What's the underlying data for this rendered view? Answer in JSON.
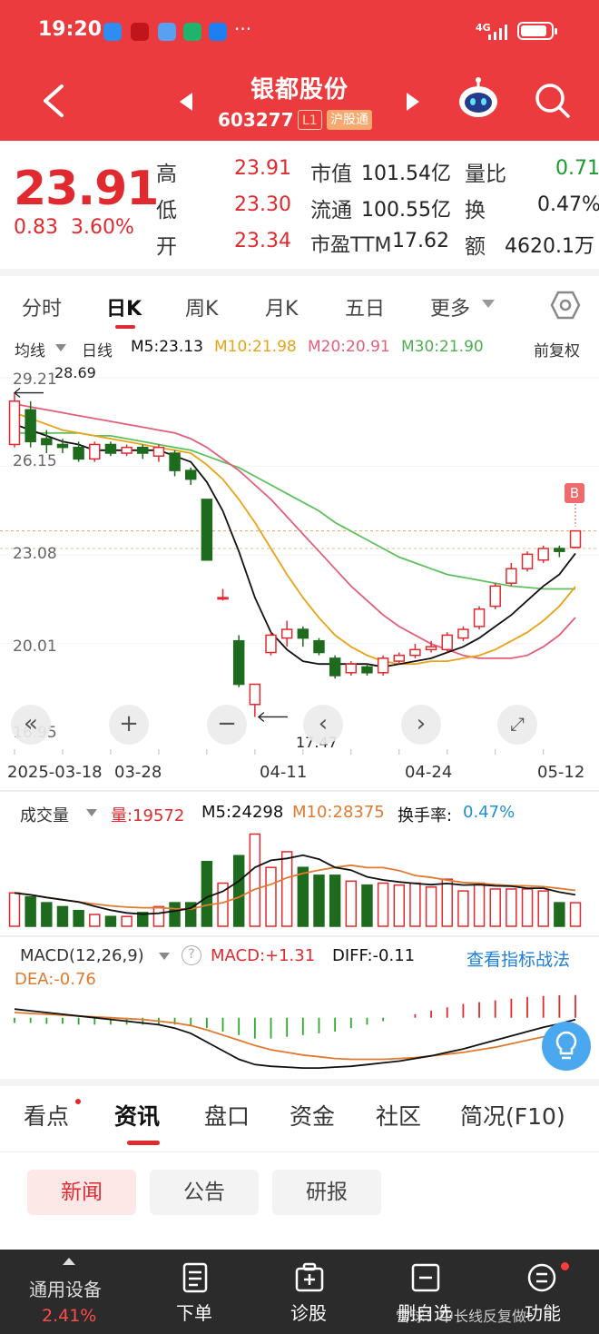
{
  "status_bar": {
    "time": "19:20",
    "more": "···",
    "network": "4G"
  },
  "header": {
    "title": "银都股份",
    "code": "603277",
    "level_badge": "L1",
    "connect_badge": "沪股通"
  },
  "quote": {
    "price": "23.91",
    "change": "0.83",
    "change_pct": "3.60%",
    "high_label": "高",
    "high": "23.91",
    "low_label": "低",
    "low": "23.30",
    "open_label": "开",
    "open": "23.34",
    "mcap_label": "市值",
    "mcap": "101.54亿",
    "float_label": "流通",
    "float": "100.55亿",
    "pe_label": "市盈TTM",
    "pe": "17.62",
    "volratio_label": "量比",
    "volratio": "0.71",
    "turnover_label": "换",
    "turnover": "0.47%",
    "amount_label": "额",
    "amount": "4620.1万"
  },
  "chart_tabs": [
    "分时",
    "日K",
    "周K",
    "月K",
    "五日",
    "更多"
  ],
  "ma_bar": {
    "selector": "均线",
    "period": "日线",
    "ma5": "M5:23.13",
    "ma10": "M10:21.98",
    "ma20": "M20:20.91",
    "ma30": "M30:21.90",
    "adjust": "前复权"
  },
  "price_axis": [
    "29.21",
    "26.15",
    "23.08",
    "20.01",
    "16.95"
  ],
  "annotations": {
    "high_mark": "28.69",
    "low_mark": "17.47",
    "buy_marker": "B"
  },
  "date_axis": [
    "2025-03-18",
    "03-28",
    "04-11",
    "04-24",
    "05-12"
  ],
  "volume_bar": {
    "selector": "成交量",
    "vol": "量:19572",
    "m5": "M5:24298",
    "m10": "M10:28375",
    "turnover_label": "换手率:",
    "turnover": "0.47%"
  },
  "macd_bar": {
    "selector": "MACD(12,26,9)",
    "help": "?",
    "macd": "MACD:+1.31",
    "diff": "DIFF:-0.11",
    "link": "查看指标战法",
    "dea": "DEA:-0.76"
  },
  "bottom_tabs": [
    "看点",
    "资讯",
    "盘口",
    "资金",
    "社区",
    "简况(F10)"
  ],
  "sub_tabs": [
    "新闻",
    "公告",
    "研报"
  ],
  "bottom_nav": {
    "device_label": "通用设备",
    "device_pct": "2.41%",
    "items": [
      "下单",
      "诊股",
      "删自选",
      "功能"
    ],
    "watermark": "雪球：中长线反复做t"
  },
  "colors": {
    "up": "#e02a2f",
    "down": "#1e6b1e",
    "header": "#ec3b3e",
    "ma5": "#111111",
    "ma10": "#e8a317",
    "ma20": "#e0607a",
    "ma30": "#5fbf5f"
  },
  "chart_data": {
    "type": "candlestick",
    "dates_labeled": [
      "2025-03-18",
      "03-28",
      "04-11",
      "04-24",
      "05-12"
    ],
    "ylim": [
      16.95,
      29.21
    ],
    "candles": [
      {
        "o": 26.9,
        "c": 28.4,
        "h": 28.69,
        "l": 26.8
      },
      {
        "o": 28.1,
        "c": 27.0,
        "h": 28.4,
        "l": 26.8
      },
      {
        "o": 27.1,
        "c": 26.9,
        "h": 27.4,
        "l": 26.6
      },
      {
        "o": 26.9,
        "c": 26.8,
        "h": 27.1,
        "l": 26.6
      },
      {
        "o": 26.8,
        "c": 26.4,
        "h": 27.0,
        "l": 26.3
      },
      {
        "o": 26.4,
        "c": 26.9,
        "h": 27.0,
        "l": 26.3
      },
      {
        "o": 26.9,
        "c": 26.6,
        "h": 27.0,
        "l": 26.5
      },
      {
        "o": 26.6,
        "c": 26.8,
        "h": 26.9,
        "l": 26.5
      },
      {
        "o": 26.8,
        "c": 26.6,
        "h": 26.9,
        "l": 26.4
      },
      {
        "o": 26.5,
        "c": 26.8,
        "h": 26.9,
        "l": 26.3
      },
      {
        "o": 26.6,
        "c": 26.0,
        "h": 26.7,
        "l": 25.8
      },
      {
        "o": 26.0,
        "c": 25.7,
        "h": 26.1,
        "l": 25.5
      },
      {
        "o": 25.0,
        "c": 22.9,
        "h": 25.0,
        "l": 22.9
      },
      {
        "o": 21.6,
        "c": 21.6,
        "h": 21.9,
        "l": 21.5
      },
      {
        "o": 20.1,
        "c": 18.6,
        "h": 20.3,
        "l": 18.5
      },
      {
        "o": 17.9,
        "c": 18.6,
        "h": 18.6,
        "l": 17.47
      },
      {
        "o": 19.7,
        "c": 20.3,
        "h": 20.4,
        "l": 19.6
      },
      {
        "o": 20.2,
        "c": 20.5,
        "h": 20.8,
        "l": 19.9
      },
      {
        "o": 20.5,
        "c": 20.2,
        "h": 20.6,
        "l": 19.9
      },
      {
        "o": 20.1,
        "c": 19.7,
        "h": 20.2,
        "l": 19.6
      },
      {
        "o": 19.5,
        "c": 18.9,
        "h": 19.6,
        "l": 18.8
      },
      {
        "o": 19.0,
        "c": 19.3,
        "h": 19.4,
        "l": 18.9
      },
      {
        "o": 19.2,
        "c": 19.0,
        "h": 19.3,
        "l": 18.9
      },
      {
        "o": 19.0,
        "c": 19.5,
        "h": 19.6,
        "l": 18.9
      },
      {
        "o": 19.4,
        "c": 19.6,
        "h": 19.7,
        "l": 19.3
      },
      {
        "o": 19.6,
        "c": 19.8,
        "h": 20.0,
        "l": 19.5
      },
      {
        "o": 19.8,
        "c": 19.9,
        "h": 20.1,
        "l": 19.7
      },
      {
        "o": 19.8,
        "c": 20.3,
        "h": 20.4,
        "l": 19.7
      },
      {
        "o": 20.2,
        "c": 20.5,
        "h": 20.6,
        "l": 20.1
      },
      {
        "o": 20.6,
        "c": 21.2,
        "h": 21.3,
        "l": 20.5
      },
      {
        "o": 21.3,
        "c": 22.0,
        "h": 22.1,
        "l": 21.2
      },
      {
        "o": 22.1,
        "c": 22.6,
        "h": 22.8,
        "l": 22.0
      },
      {
        "o": 22.6,
        "c": 23.1,
        "h": 23.2,
        "l": 22.5
      },
      {
        "o": 22.9,
        "c": 23.3,
        "h": 23.4,
        "l": 22.8
      },
      {
        "o": 23.3,
        "c": 23.2,
        "h": 23.4,
        "l": 23.0
      },
      {
        "o": 23.34,
        "c": 23.91,
        "h": 23.91,
        "l": 23.3
      }
    ],
    "ma5": [
      27.6,
      27.4,
      27.2,
      27.0,
      26.9,
      26.7,
      26.7,
      26.7,
      26.7,
      26.7,
      26.5,
      26.3,
      25.6,
      24.6,
      23.2,
      21.6,
      20.4,
      19.8,
      19.4,
      19.3,
      19.3,
      19.3,
      19.3,
      19.2,
      19.3,
      19.4,
      19.5,
      19.7,
      19.9,
      20.2,
      20.6,
      21.0,
      21.5,
      22.0,
      22.4,
      23.13
    ],
    "ma10": [
      28.0,
      27.8,
      27.6,
      27.4,
      27.3,
      27.2,
      27.1,
      27.0,
      26.9,
      26.8,
      26.7,
      26.6,
      26.2,
      25.7,
      25.0,
      24.2,
      23.3,
      22.4,
      21.6,
      20.9,
      20.3,
      19.9,
      19.6,
      19.4,
      19.3,
      19.3,
      19.4,
      19.4,
      19.5,
      19.6,
      19.8,
      20.1,
      20.4,
      20.8,
      21.3,
      21.98
    ],
    "ma20": [
      28.3,
      28.2,
      28.1,
      28.0,
      27.9,
      27.8,
      27.7,
      27.6,
      27.5,
      27.4,
      27.3,
      27.1,
      26.8,
      26.4,
      26.0,
      25.5,
      25.0,
      24.4,
      23.8,
      23.2,
      22.6,
      22.0,
      21.5,
      21.0,
      20.6,
      20.3,
      20.0,
      19.8,
      19.6,
      19.5,
      19.5,
      19.5,
      19.6,
      19.9,
      20.3,
      20.91
    ],
    "ma30": [
      27.3,
      27.3,
      27.3,
      27.3,
      27.3,
      27.2,
      27.2,
      27.1,
      27.0,
      26.9,
      26.8,
      26.7,
      26.5,
      26.3,
      26.1,
      25.8,
      25.5,
      25.2,
      24.9,
      24.6,
      24.2,
      23.9,
      23.6,
      23.3,
      23.0,
      22.8,
      22.6,
      22.4,
      22.3,
      22.2,
      22.1,
      22.0,
      21.95,
      21.9,
      21.9,
      21.9
    ],
    "volume": [
      17,
      15,
      12,
      10,
      8,
      6,
      5,
      5,
      7,
      10,
      12,
      12,
      33,
      22,
      36,
      47,
      30,
      38,
      30,
      26,
      26,
      23,
      21,
      22,
      21,
      22,
      20,
      24,
      18,
      22,
      19,
      19,
      19,
      18,
      12,
      12
    ],
    "macd_hist": [
      -0.3,
      -0.3,
      -0.35,
      -0.35,
      -0.4,
      -0.4,
      -0.4,
      -0.4,
      -0.4,
      -0.4,
      -0.4,
      -0.45,
      -0.6,
      -0.8,
      -1.0,
      -1.2,
      -1.2,
      -1.1,
      -1.0,
      -0.9,
      -0.8,
      -0.6,
      -0.4,
      -0.2,
      0.0,
      0.2,
      0.4,
      0.6,
      0.8,
      0.9,
      1.0,
      1.1,
      1.2,
      1.25,
      1.3,
      1.31
    ],
    "diff": [
      0.5,
      0.4,
      0.3,
      0.2,
      0.1,
      0.0,
      -0.1,
      -0.2,
      -0.3,
      -0.4,
      -0.6,
      -0.9,
      -1.4,
      -1.9,
      -2.4,
      -2.7,
      -2.8,
      -2.85,
      -2.9,
      -2.9,
      -2.85,
      -2.8,
      -2.7,
      -2.6,
      -2.5,
      -2.35,
      -2.2,
      -2.0,
      -1.8,
      -1.55,
      -1.3,
      -1.05,
      -0.8,
      -0.55,
      -0.35,
      -0.11
    ],
    "dea": [
      0.3,
      0.25,
      0.2,
      0.15,
      0.1,
      0.05,
      0.0,
      -0.05,
      -0.1,
      -0.2,
      -0.3,
      -0.45,
      -0.7,
      -1.0,
      -1.3,
      -1.6,
      -1.85,
      -2.0,
      -2.15,
      -2.25,
      -2.35,
      -2.4,
      -2.4,
      -2.4,
      -2.35,
      -2.3,
      -2.2,
      -2.1,
      -2.0,
      -1.85,
      -1.7,
      -1.5,
      -1.3,
      -1.1,
      -0.9,
      -0.76
    ]
  }
}
